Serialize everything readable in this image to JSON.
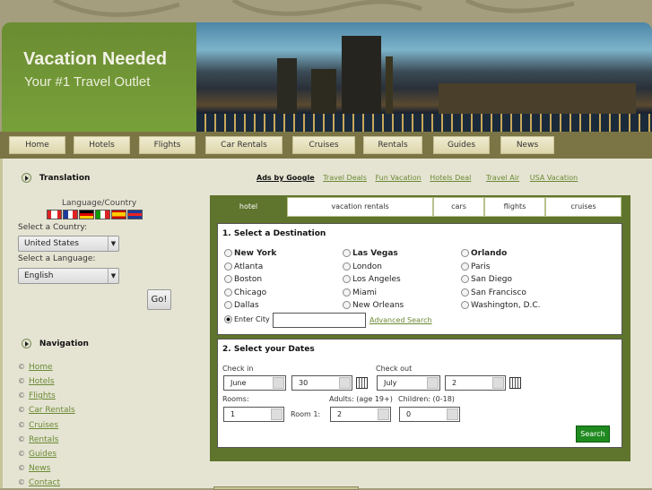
{
  "header": {
    "title": "Vacation Needed",
    "tagline": "Your #1 Travel Outlet"
  },
  "nav": [
    "Home",
    "Hotels",
    "Flights",
    "Car Rentals",
    "Cruises",
    "Rentals",
    "Guides",
    "News"
  ],
  "translation": {
    "heading": "Translation",
    "lang_country": "Language/Country",
    "flags": [
      "canada",
      "france",
      "germany",
      "italy",
      "spain",
      "uk"
    ],
    "country_label": "Select a Country:",
    "country_value": "United States",
    "language_label": "Select a Language:",
    "language_value": "English",
    "go": "Go!"
  },
  "ads": {
    "label": "Ads by Google",
    "links": [
      "Travel Deals",
      "Fun Vacation",
      "Hotels Deal",
      "Travel Air",
      "USA Vacation"
    ]
  },
  "navigation": {
    "heading": "Navigation",
    "items": [
      "Home",
      "Hotels",
      "Flights",
      "Car Rentals",
      "Cruises",
      "Rentals",
      "Guides",
      "News",
      "Contact"
    ]
  },
  "tabs": [
    "hotel",
    "vacation rentals",
    "cars",
    "flights",
    "cruises"
  ],
  "destination": {
    "heading": "1. Select a Destination",
    "col1": [
      "New York",
      "Atlanta",
      "Boston",
      "Chicago",
      "Dallas"
    ],
    "col2": [
      "Las Vegas",
      "London",
      "Los Angeles",
      "Miami",
      "New Orleans"
    ],
    "col3": [
      "Orlando",
      "Paris",
      "San Diego",
      "San Francisco",
      "Washington, D.C."
    ],
    "enter_city": "Enter City",
    "city_value": "",
    "advanced": "Advanced Search"
  },
  "dates": {
    "heading": "2. Select your Dates",
    "checkin": "Check in",
    "checkout": "Check out",
    "in_month": "June",
    "in_day": "30",
    "out_month": "July",
    "out_day": "2",
    "rooms_label": "Rooms:",
    "rooms": "1",
    "room1": "Room 1:",
    "adults_label": "Adults: (age 19+)",
    "adults": "2",
    "children_label": "Children: (0-18)",
    "children": "0",
    "search": "Search"
  },
  "colors": {
    "green": "#5f742c",
    "nav": "#7b7545",
    "bg": "#e5e4d3",
    "search": "#1f8a1f"
  }
}
